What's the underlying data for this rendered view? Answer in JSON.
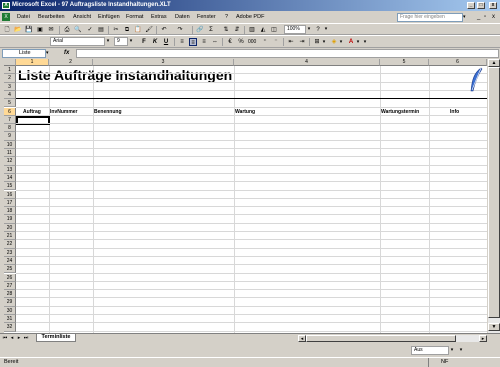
{
  "window": {
    "title": "Microsoft Excel - 97 Auftragsliste Instandhaltungen.XLT",
    "app_icon": "X"
  },
  "menu": {
    "items": [
      "Datei",
      "Bearbeiten",
      "Ansicht",
      "Einfügen",
      "Format",
      "Extras",
      "Daten",
      "Fenster",
      "?",
      "Adobe PDF"
    ],
    "help_placeholder": "Frage hier eingeben"
  },
  "toolbar": {
    "zoom": "100%",
    "help_btn": "?"
  },
  "format_bar": {
    "font": "Arial",
    "size": "9",
    "bold": "F",
    "italic": "K",
    "underline": "U",
    "currency": "€",
    "percent": "%",
    "thousands": "000"
  },
  "formula_bar": {
    "name_box": "Liste",
    "fx": "fx",
    "content": ""
  },
  "sheet": {
    "columns": [
      "1",
      "2",
      "3",
      "4",
      "5",
      "6"
    ],
    "rows": [
      "1",
      "2",
      "3",
      "4",
      "5",
      "6",
      "7",
      "8",
      "9",
      "10",
      "11",
      "12",
      "13",
      "14",
      "15",
      "16",
      "17",
      "18",
      "19",
      "20",
      "21",
      "22",
      "23",
      "24",
      "25",
      "26",
      "27",
      "28",
      "29",
      "30",
      "31",
      "32"
    ],
    "title": "Liste Aufträge Instandhaltungen",
    "headers": [
      "Auftrag",
      "InvNummer",
      "Benennung",
      "Wartung",
      "Wartungstermin",
      "Info"
    ],
    "active_row": 6,
    "active_col": 1
  },
  "tabs": {
    "active": "Terminliste"
  },
  "bottom": {
    "zoom_select": "Aus"
  },
  "status": {
    "left": "Bereit",
    "right": "NF"
  },
  "colors": {
    "title_bar_start": "#0a246a",
    "title_bar_end": "#a6caf0",
    "chrome": "#d4d0c8",
    "quill": "#3b6fd1"
  }
}
